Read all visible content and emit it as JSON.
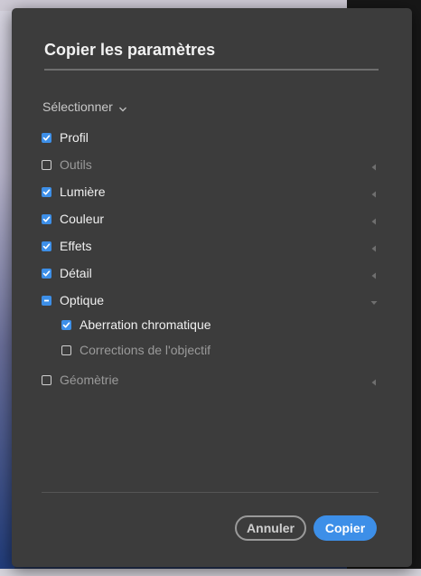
{
  "dialog": {
    "title": "Copier les paramètres",
    "select_label": "Sélectionner",
    "cancel_label": "Annuler",
    "copy_label": "Copier"
  },
  "options": [
    {
      "label": "Profil",
      "state": "checked",
      "arrow": "none",
      "level": 0
    },
    {
      "label": "Outils",
      "state": "unchecked",
      "arrow": "left",
      "level": 0
    },
    {
      "label": "Lumière",
      "state": "checked",
      "arrow": "left",
      "level": 0
    },
    {
      "label": "Couleur",
      "state": "checked",
      "arrow": "left",
      "level": 0
    },
    {
      "label": "Effets",
      "state": "checked",
      "arrow": "left",
      "level": 0
    },
    {
      "label": "Détail",
      "state": "checked",
      "arrow": "left",
      "level": 0
    },
    {
      "label": "Optique",
      "state": "mixed",
      "arrow": "down",
      "level": 0
    },
    {
      "label": "Aberration chromatique",
      "state": "checked",
      "arrow": "none",
      "level": 1
    },
    {
      "label": "Corrections de l'objectif",
      "state": "unchecked",
      "arrow": "none",
      "level": 1
    },
    {
      "label": "Géomètrie",
      "state": "unchecked",
      "arrow": "left",
      "level": 0
    }
  ],
  "icons": {
    "check": "check-icon",
    "mixed": "minus-icon",
    "collapsed": "caret-left-icon",
    "expanded": "caret-down-icon",
    "dropdown": "chevron-down-icon"
  },
  "colors": {
    "accent": "#3d8fe8",
    "dialog_bg": "#3c3c3c",
    "text_on": "#f0f0f0",
    "text_off": "#9a9a9a"
  }
}
